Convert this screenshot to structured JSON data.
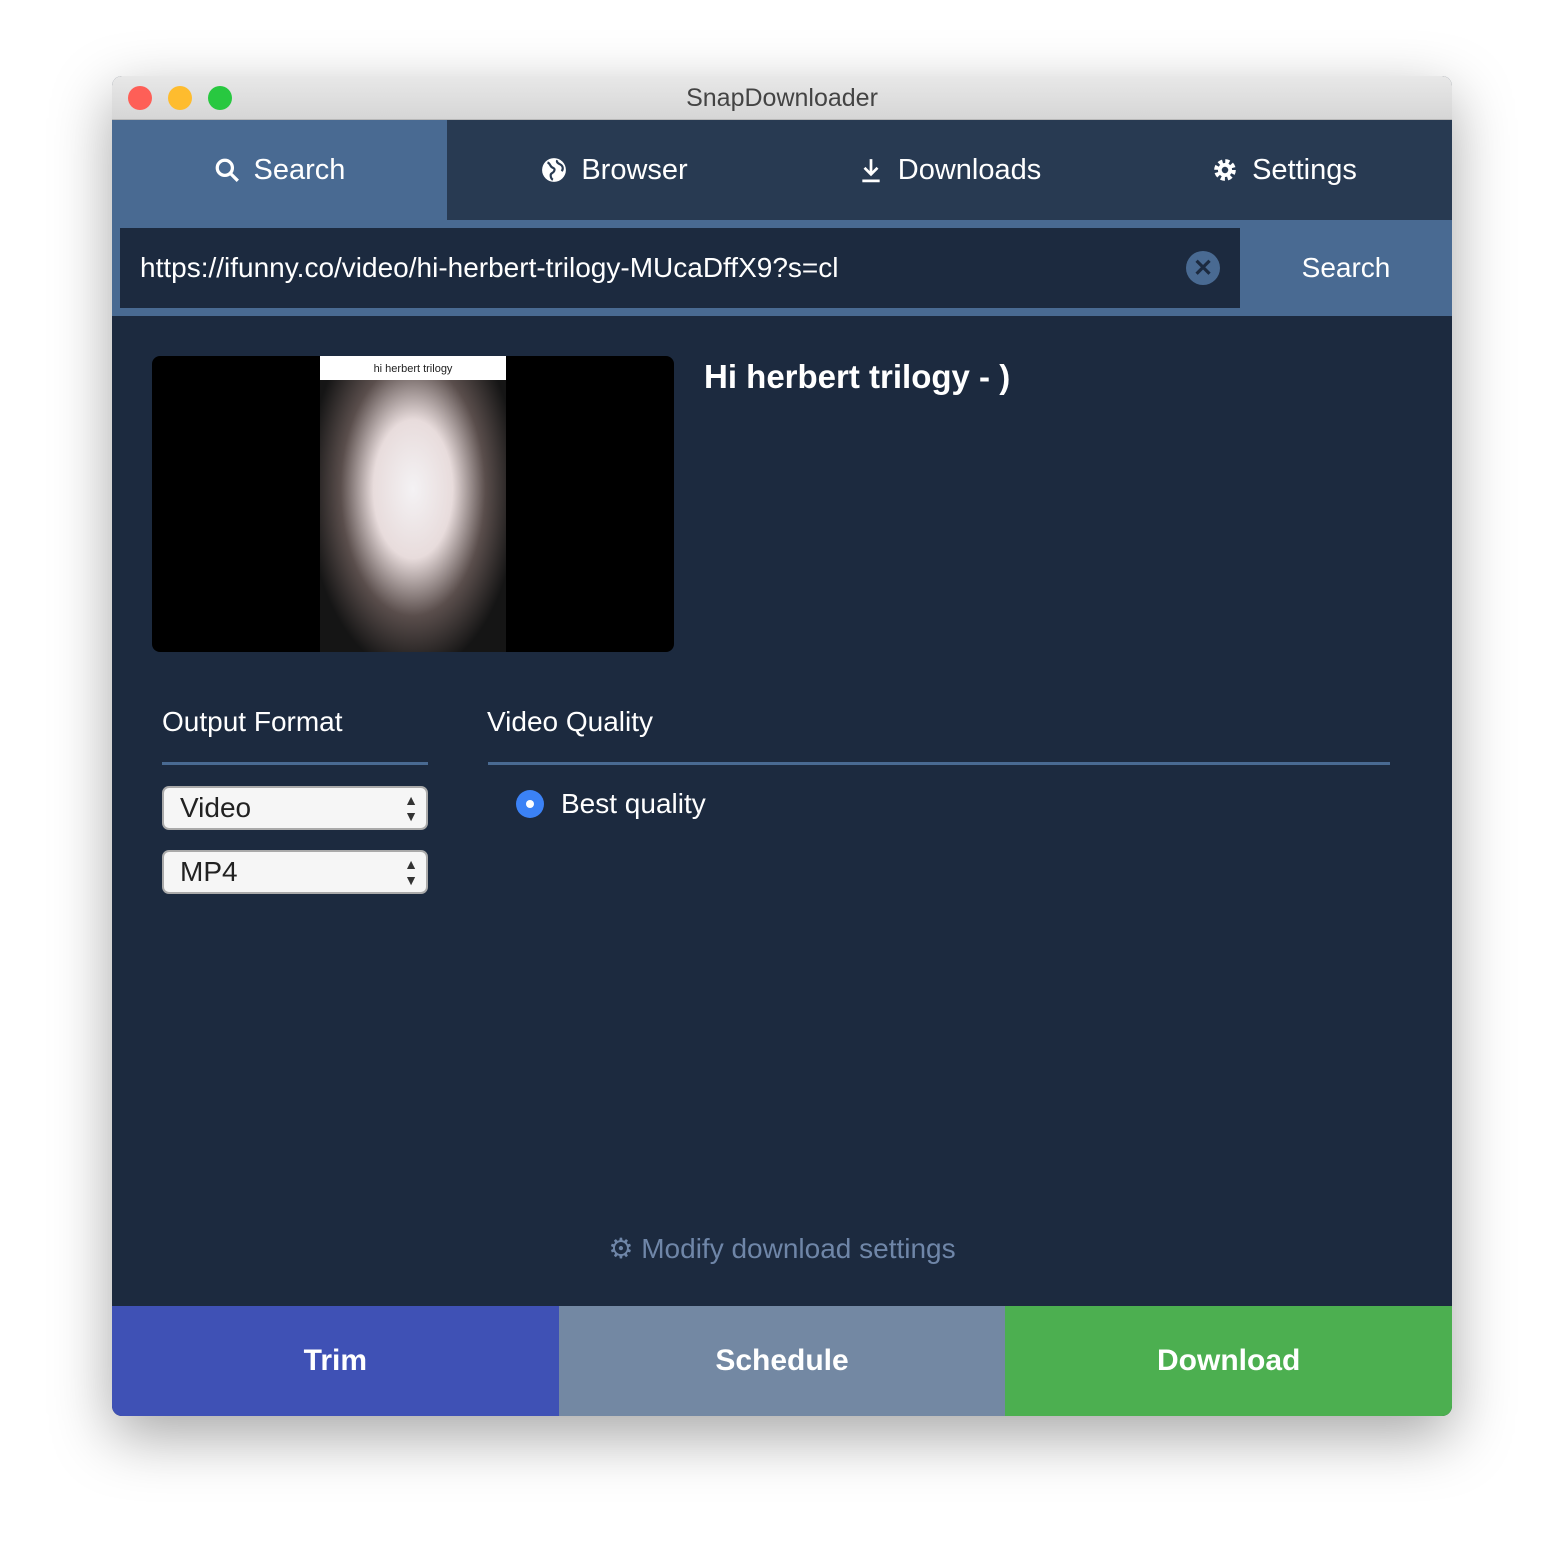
{
  "window": {
    "title": "SnapDownloader"
  },
  "tabs": [
    {
      "label": "Search",
      "icon": "search-icon"
    },
    {
      "label": "Browser",
      "icon": "globe-icon"
    },
    {
      "label": "Downloads",
      "icon": "download-icon"
    },
    {
      "label": "Settings",
      "icon": "gear-icon"
    }
  ],
  "search": {
    "url": "https://ifunny.co/video/hi-herbert-trilogy-MUcaDffX9?s=cl",
    "button": "Search",
    "clear": "✕"
  },
  "video": {
    "title": "Hi herbert trilogy - )",
    "thumbnail_caption": "hi herbert trilogy"
  },
  "output_format": {
    "label": "Output Format",
    "type": "Video",
    "container": "MP4"
  },
  "video_quality": {
    "label": "Video Quality",
    "options": [
      {
        "label": "Best quality",
        "selected": true
      }
    ]
  },
  "modify_link": "Modify download settings",
  "actions": {
    "trim": "Trim",
    "schedule": "Schedule",
    "download": "Download"
  },
  "colors": {
    "trim": "#3f51b5",
    "schedule": "#7388a3",
    "download": "#4caf50",
    "accent": "#496a92"
  }
}
